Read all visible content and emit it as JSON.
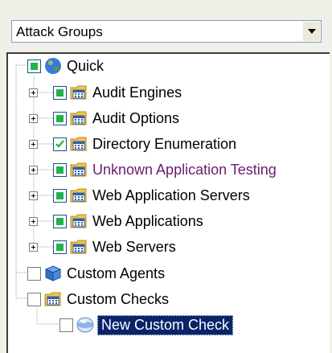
{
  "combo": {
    "value": "Attack Groups"
  },
  "tree": {
    "root": {
      "label": "Quick",
      "icon": "globe-icon",
      "state": "partial"
    },
    "quick_children": [
      {
        "label": "Audit Engines",
        "state": "partial",
        "icon": "folder-grid-icon"
      },
      {
        "label": "Audit Options",
        "state": "partial",
        "icon": "folder-grid-icon"
      },
      {
        "label": "Directory Enumeration",
        "state": "checked",
        "icon": "folder-grid-icon"
      },
      {
        "label": "Unknown Application Testing",
        "state": "partial",
        "icon": "folder-grid-icon",
        "color": "#6a1b6f"
      },
      {
        "label": "Web Application Servers",
        "state": "partial",
        "icon": "folder-grid-icon"
      },
      {
        "label": "Web Applications",
        "state": "partial",
        "icon": "folder-grid-icon"
      },
      {
        "label": "Web Servers",
        "state": "partial",
        "icon": "folder-grid-icon"
      }
    ],
    "custom_agents": {
      "label": "Custom Agents",
      "icon": "cube-icon",
      "state": "empty"
    },
    "custom_checks": {
      "label": "Custom Checks",
      "icon": "folder-grid-icon",
      "state": "empty"
    },
    "new_custom_check": {
      "label": "New Custom Check",
      "icon": "bubble-icon",
      "state": "empty",
      "selected": true
    }
  },
  "colors": {
    "selection": "#0a246a",
    "check_fill": "#22b24c",
    "folder": "#f3c34a"
  }
}
